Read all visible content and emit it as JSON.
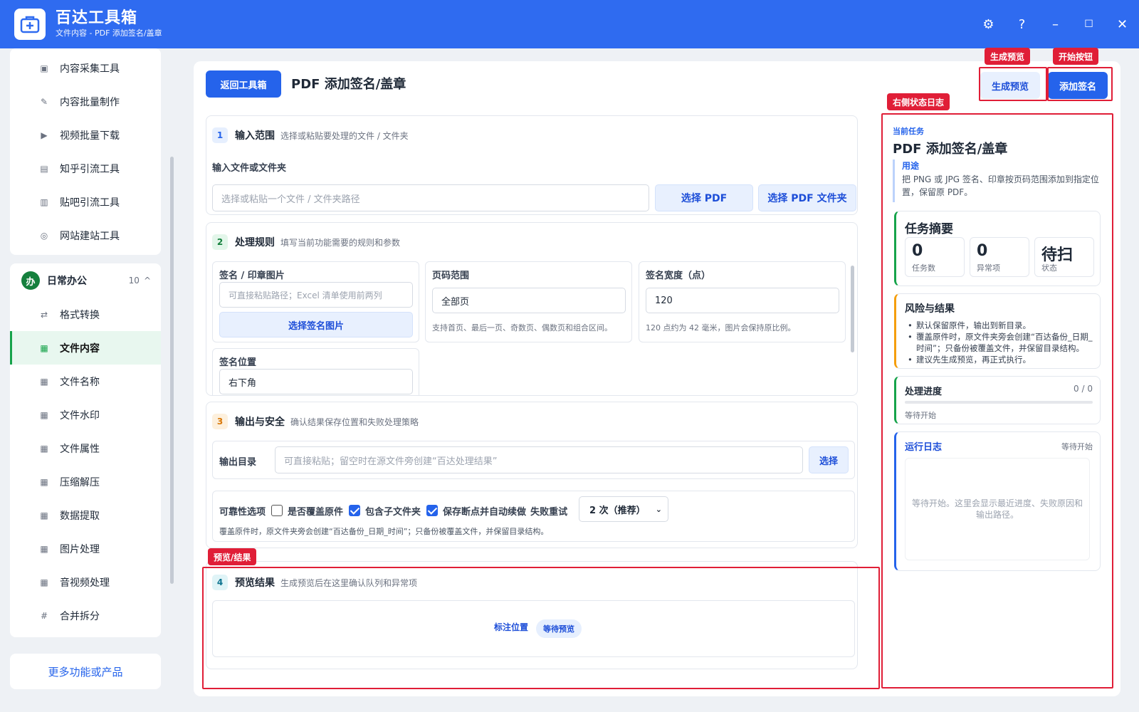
{
  "app": {
    "title": "百达工具箱",
    "subtitle": "文件内容 - PDF 添加签名/盖章",
    "window_controls": {
      "settings": "⚙",
      "help": "?",
      "minimize": "–",
      "maximize": "☐",
      "close": "✕"
    }
  },
  "sidebar": {
    "top_items": [
      {
        "label": "内容采集工具",
        "icon": "▣"
      },
      {
        "label": "内容批量制作",
        "icon": "✎"
      },
      {
        "label": "视频批量下载",
        "icon": "▶"
      },
      {
        "label": "知乎引流工具",
        "icon": "▤"
      },
      {
        "label": "贴吧引流工具",
        "icon": "▥"
      },
      {
        "label": "网站建站工具",
        "icon": "◎"
      }
    ],
    "group": {
      "badge": "办",
      "title": "日常办公",
      "count": "10",
      "caret": "^"
    },
    "group_items": [
      {
        "label": "格式转换",
        "icon": "⇄"
      },
      {
        "label": "文件内容",
        "icon": "▦"
      },
      {
        "label": "文件名称",
        "icon": "▦"
      },
      {
        "label": "文件水印",
        "icon": "▦"
      },
      {
        "label": "文件属性",
        "icon": "▦"
      },
      {
        "label": "压缩解压",
        "icon": "▦"
      },
      {
        "label": "数据提取",
        "icon": "▦"
      },
      {
        "label": "图片处理",
        "icon": "▦"
      },
      {
        "label": "音视频处理",
        "icon": "▦"
      },
      {
        "label": "合并拆分",
        "icon": "#"
      }
    ],
    "more_label": "更多功能或产品"
  },
  "toolbar": {
    "back_label": "返回工具箱",
    "page_title": "PDF 添加签名/盖章",
    "preview_label": "生成预览",
    "start_label": "添加签名"
  },
  "section1": {
    "num": "1",
    "title": "输入范围",
    "desc": "选择或粘贴要处理的文件 / 文件夹",
    "field_label": "输入文件或文件夹",
    "input_placeholder": "选择或粘贴一个文件 / 文件夹路径",
    "btn_pdf": "选择 PDF",
    "btn_folder": "选择 PDF 文件夹"
  },
  "section2": {
    "num": "2",
    "title": "处理规则",
    "desc": "填写当前功能需要的规则和参数",
    "sig_label": "签名 / 印章图片",
    "sig_placeholder": "可直接粘贴路径；Excel 清单使用前两列",
    "sig_btn": "选择签名图片",
    "page_label": "页码范围",
    "page_value": "全部页",
    "page_hint": "支持首页、最后一页、奇数页、偶数页和组合区间。",
    "width_label": "签名宽度（点）",
    "width_value": "120",
    "width_hint": "120 点约为 42 毫米，图片会保持原比例。",
    "pos_label": "签名位置",
    "pos_value": "右下角"
  },
  "section3": {
    "num": "3",
    "title": "输出与安全",
    "desc": "确认结果保存位置和失败处理策略",
    "out_label": "输出目录",
    "out_placeholder": "可直接粘贴；留空时在源文件旁创建“百达处理结果”",
    "out_btn": "选择",
    "rel_label": "可靠性选项",
    "opt_overwrite": "是否覆盖原件",
    "opt_subfolder": "包含子文件夹",
    "opt_resume": "保存断点并自动续做",
    "retry_label": "失败重试",
    "retry_value": "2 次（推荐）",
    "note": "覆盖原件时，原文件夹旁会创建“百达备份_日期_时间”；只备份被覆盖文件，并保留目录结构。"
  },
  "section4": {
    "num": "4",
    "title": "预览结果",
    "desc": "生成预览后在这里确认队列和异常项",
    "mark_label": "标注位置",
    "wait_badge": "等待预览"
  },
  "right_panel": {
    "current_label": "当前任务",
    "current_title": "PDF 添加签名/盖章",
    "usage_label": "用途",
    "usage_text": "把 PNG 或 JPG 签名、印章按页码范围添加到指定位置，保留原 PDF。",
    "summary_title": "任务摘要",
    "stats": [
      {
        "value": "0",
        "label": "任务数"
      },
      {
        "value": "0",
        "label": "异常项"
      },
      {
        "value": "待扫",
        "label": "状态"
      }
    ],
    "risk_title": "风险与结果",
    "risks": [
      "默认保留原件，输出到新目录。",
      "覆盖原件时，原文件夹旁会创建“百达备份_日期_时间”；只备份被覆盖文件，并保留目录结构。",
      "建议先生成预览，再正式执行。"
    ],
    "progress_title": "处理进度",
    "progress_count": "0 / 0",
    "progress_fraction": 0,
    "progress_status": "等待开始",
    "log_title": "运行日志",
    "log_status": "等待开始",
    "log_placeholder": "等待开始。这里会显示最近进度、失败原因和输出路径。"
  },
  "annotations": {
    "preview": "生成预览",
    "start": "开始按钮",
    "log": "右侧状态日志",
    "result": "预览/结果"
  },
  "colors": {
    "brand": "#2f6bf0",
    "accent": "#2563eb",
    "active_green": "#16a34a",
    "highlight": "#e01e37"
  }
}
